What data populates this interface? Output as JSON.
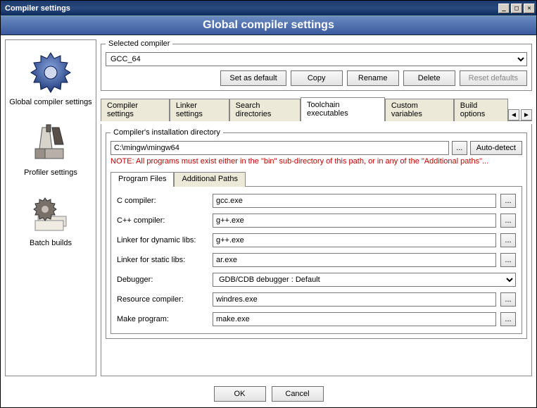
{
  "window": {
    "title": "Compiler settings"
  },
  "header": {
    "title": "Global compiler settings"
  },
  "sidebar": {
    "items": [
      {
        "label": "Global compiler settings"
      },
      {
        "label": "Profiler settings"
      },
      {
        "label": "Batch builds"
      }
    ]
  },
  "selected_compiler": {
    "legend": "Selected compiler",
    "value": "GCC_64",
    "buttons": {
      "set_default": "Set as default",
      "copy": "Copy",
      "rename": "Rename",
      "delete": "Delete",
      "reset": "Reset defaults"
    }
  },
  "tabs": [
    "Compiler settings",
    "Linker settings",
    "Search directories",
    "Toolchain executables",
    "Custom variables",
    "Build options"
  ],
  "active_tab_index": 3,
  "install_dir": {
    "legend": "Compiler's installation directory",
    "value": "C:\\mingw\\mingw64",
    "note": "NOTE: All programs must exist either in the \"bin\" sub-directory of this path, or in any of the \"Additional paths\"...",
    "autodetect": "Auto-detect"
  },
  "subtabs": [
    "Program Files",
    "Additional Paths"
  ],
  "active_subtab_index": 0,
  "programs": {
    "c_compiler": {
      "label": "C compiler:",
      "value": "gcc.exe"
    },
    "cpp_compiler": {
      "label": "C++ compiler:",
      "value": "g++.exe"
    },
    "linker_dyn": {
      "label": "Linker for dynamic libs:",
      "value": "g++.exe"
    },
    "linker_static": {
      "label": "Linker for static libs:",
      "value": "ar.exe"
    },
    "debugger": {
      "label": "Debugger:",
      "value": "GDB/CDB debugger : Default"
    },
    "res_compiler": {
      "label": "Resource compiler:",
      "value": "windres.exe"
    },
    "make": {
      "label": "Make program:",
      "value": "make.exe"
    }
  },
  "bottom": {
    "ok": "OK",
    "cancel": "Cancel"
  }
}
